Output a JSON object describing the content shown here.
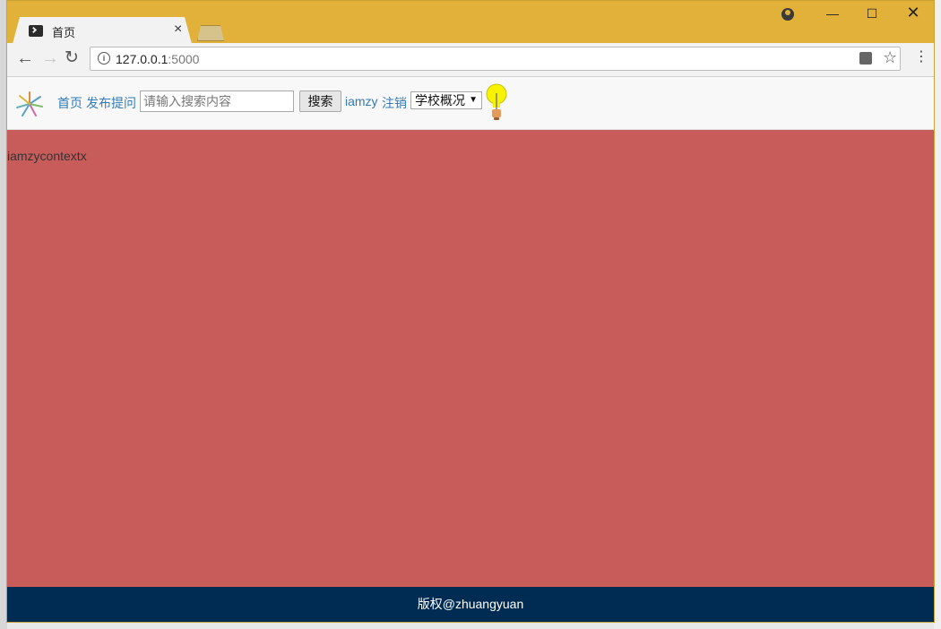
{
  "browser": {
    "tab_title": "首页",
    "close_glyph": "×",
    "url_host": "127.0.0.1",
    "url_port": ":5000",
    "window_controls": {
      "minimize": "—",
      "maximize": "☐",
      "close": "✕"
    }
  },
  "navbar": {
    "home_link": "首页",
    "ask_link": "发布提问",
    "search_placeholder": "请输入搜索内容",
    "search_button": "搜索",
    "user_link": "iamzy",
    "logout_link": "注销",
    "select_value": "学校概况"
  },
  "main": {
    "text": "iamzycontextx"
  },
  "footer": {
    "copyright": "版权@zhuangyuan"
  },
  "colors": {
    "titlebar": "#e1b13a",
    "page_background": "#c85c5b",
    "footer_background": "#002b53",
    "link": "#337ab7"
  }
}
